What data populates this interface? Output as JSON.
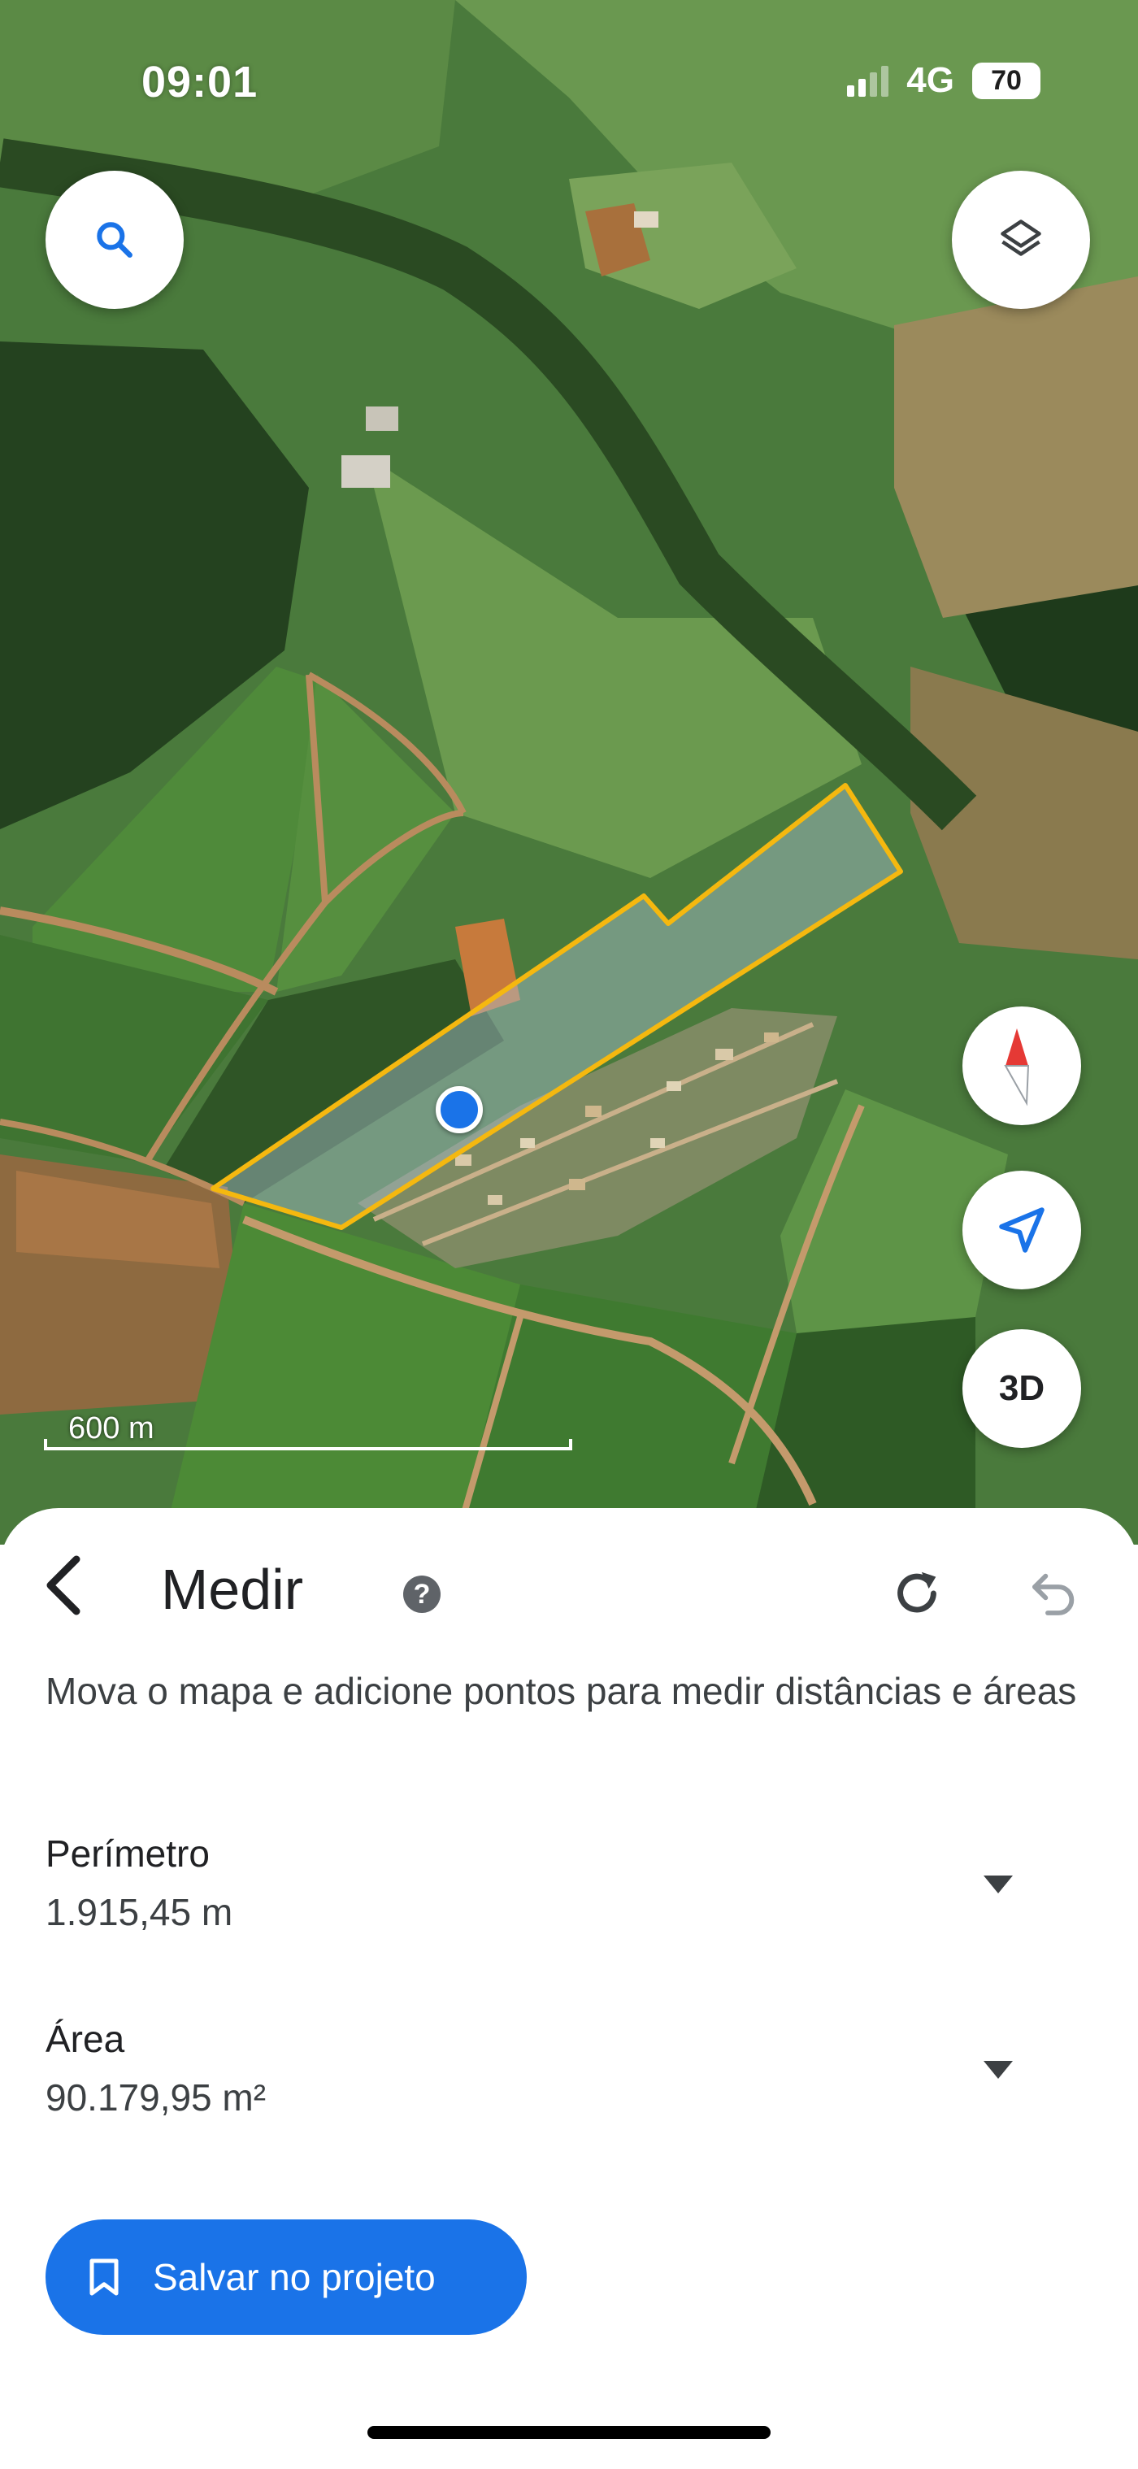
{
  "status_bar": {
    "time": "09:01",
    "network": "4G",
    "battery": "70",
    "signal_bars": 2
  },
  "map": {
    "scale_label": "600 m",
    "three_d_label": "3D",
    "buttons": {
      "search_icon": "search-icon",
      "layers_icon": "layers-icon",
      "compass_icon": "compass-icon",
      "location_icon": "navigation-arrow-icon"
    },
    "colors": {
      "measure_outline": "#f5b80f",
      "location_dot": "#1a73e8"
    }
  },
  "sheet": {
    "title": "Medir",
    "help_icon_glyph": "?",
    "instruction": "Mova o mapa e adicione pontos para medir distâncias e áreas",
    "metrics": [
      {
        "label": "Perímetro",
        "value": "1.915,45 m"
      },
      {
        "label": "Área",
        "value": "90.179,95 m²"
      }
    ],
    "save_button": "Salvar no projeto",
    "accent_color": "#1a73e8"
  }
}
